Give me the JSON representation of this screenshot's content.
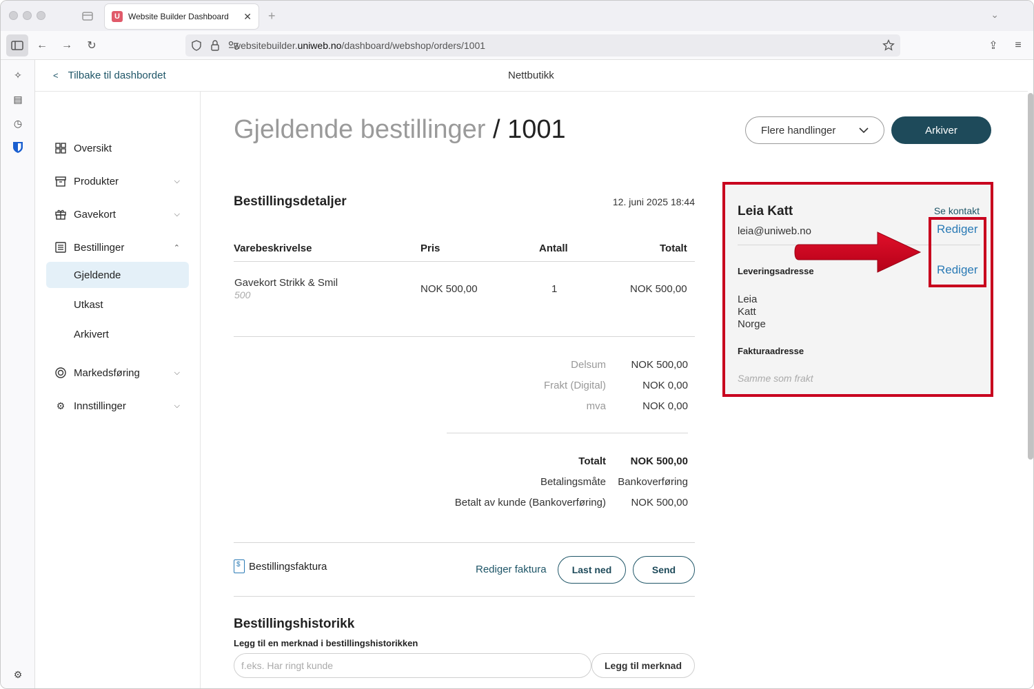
{
  "browser": {
    "tab_title": "Website Builder Dashboard",
    "url_prefix": "websitebuilder.",
    "url_domain": "uniweb.no",
    "url_path": "/dashboard/webshop/orders/1001"
  },
  "topbar": {
    "back_label": "Tilbake til dashbordet",
    "title": "Nettbutikk"
  },
  "sidebar": {
    "items": [
      {
        "label": "Oversikt",
        "icon": "grid-icon"
      },
      {
        "label": "Produkter",
        "icon": "archive-box-icon"
      },
      {
        "label": "Gavekort",
        "icon": "gift-icon"
      },
      {
        "label": "Bestillinger",
        "icon": "list-icon"
      },
      {
        "label": "Markedsføring",
        "icon": "target-icon"
      },
      {
        "label": "Innstillinger",
        "icon": "gear-icon"
      }
    ],
    "sub_items": [
      "Gjeldende",
      "Utkast",
      "Arkivert"
    ]
  },
  "header": {
    "title_prefix": "Gjeldende bestillinger",
    "title_id": "/ 1001",
    "more_actions_label": "Flere handlinger",
    "archive_label": "Arkiver"
  },
  "order": {
    "title": "Bestillingsdetaljer",
    "date": "12. juni 2025 18:44",
    "columns": [
      "Varebeskrivelse",
      "Pris",
      "Antall",
      "Totalt"
    ],
    "line": {
      "name": "Gavekort Strikk & Smil",
      "variant": "500",
      "price": "NOK 500,00",
      "qty": "1",
      "total": "NOK 500,00"
    },
    "summary": [
      {
        "label": "Delsum",
        "value": "NOK 500,00"
      },
      {
        "label": "Frakt (Digital)",
        "value": "NOK 0,00"
      },
      {
        "label": "mva",
        "value": "NOK 0,00"
      }
    ],
    "total_label": "Totalt",
    "total_value": "NOK 500,00",
    "payment_label": "Betalingsmåte",
    "payment_value": "Bankoverføring",
    "paid_label": "Betalt av kunde (Bankoverføring)",
    "paid_value": "NOK 500,00"
  },
  "invoice": {
    "label": "Bestillingsfaktura",
    "edit_label": "Rediger faktura",
    "download_label": "Last ned",
    "send_label": "Send"
  },
  "history": {
    "title": "Bestillingshistorikk",
    "field_label": "Legg til en merknad i bestillingshistorikken",
    "placeholder": "f.eks. Har ringt kunde",
    "button_label": "Legg til merknad"
  },
  "customer": {
    "name": "Leia Katt",
    "email": "leia@uniweb.no",
    "see_contact": "Se kontakt",
    "edit_label": "Rediger",
    "shipping_title": "Leveringsadresse",
    "shipping_lines": [
      "Leia",
      "Katt",
      "Norge"
    ],
    "billing_title": "Fakturaadresse",
    "billing_same": "Samme som frakt"
  },
  "colors": {
    "accent": "#1e4a5a",
    "highlight": "#c8001e",
    "link": "#2a7ab5"
  }
}
